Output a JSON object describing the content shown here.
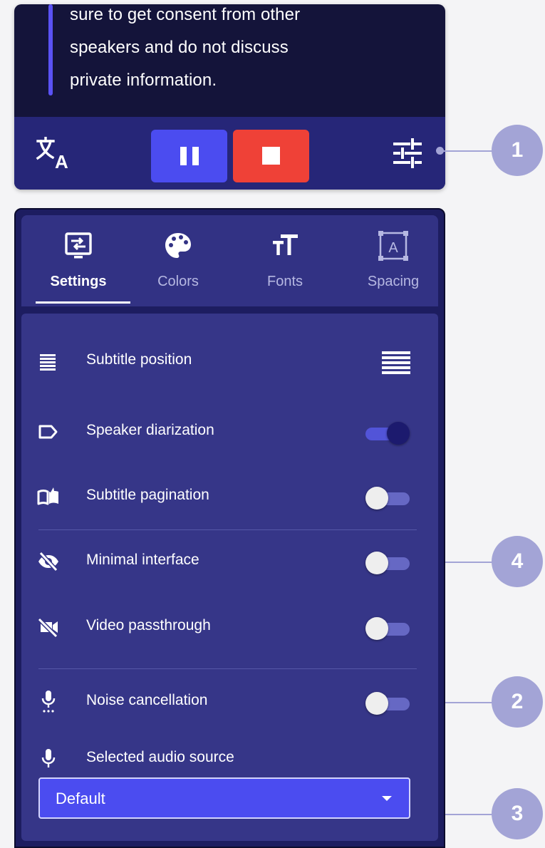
{
  "captions": {
    "lines": [
      "sure to get consent from other",
      "speakers and do not discuss",
      "private information."
    ]
  },
  "controls": {
    "translate_icon": "translate-icon",
    "pause_icon": "pause-icon",
    "stop_icon": "stop-icon",
    "settings_icon": "tune-icon"
  },
  "tabs": [
    {
      "label": "Settings",
      "icon": "settings-icon",
      "active": true
    },
    {
      "label": "Colors",
      "icon": "palette-icon",
      "active": false
    },
    {
      "label": "Fonts",
      "icon": "font-size-icon",
      "active": false
    },
    {
      "label": "Spacing",
      "icon": "spacing-icon",
      "active": false
    }
  ],
  "settings": {
    "subtitle_position": {
      "label": "Subtitle position",
      "icon": "subject-icon"
    },
    "speaker_diarization": {
      "label": "Speaker diarization",
      "icon": "label-icon",
      "enabled": true
    },
    "subtitle_pagination": {
      "label": "Subtitle pagination",
      "icon": "book-icon",
      "enabled": false
    },
    "minimal_interface": {
      "label": "Minimal interface",
      "icon": "eye-off-icon",
      "enabled": false
    },
    "video_passthrough": {
      "label": "Video passthrough",
      "icon": "video-off-icon",
      "enabled": false
    },
    "noise_cancellation": {
      "label": "Noise cancellation",
      "icon": "settings-voice-icon",
      "enabled": false
    },
    "audio_source": {
      "label": "Selected audio source",
      "icon": "mic-icon",
      "value": "Default"
    }
  },
  "callouts": [
    "1",
    "4",
    "2",
    "3"
  ],
  "colors": {
    "panel_dark": "#14143a",
    "control_bar": "#262678",
    "accent_blue": "#4b4cf0",
    "stop_red": "#ef4137",
    "callout": "#a3a4d6"
  }
}
